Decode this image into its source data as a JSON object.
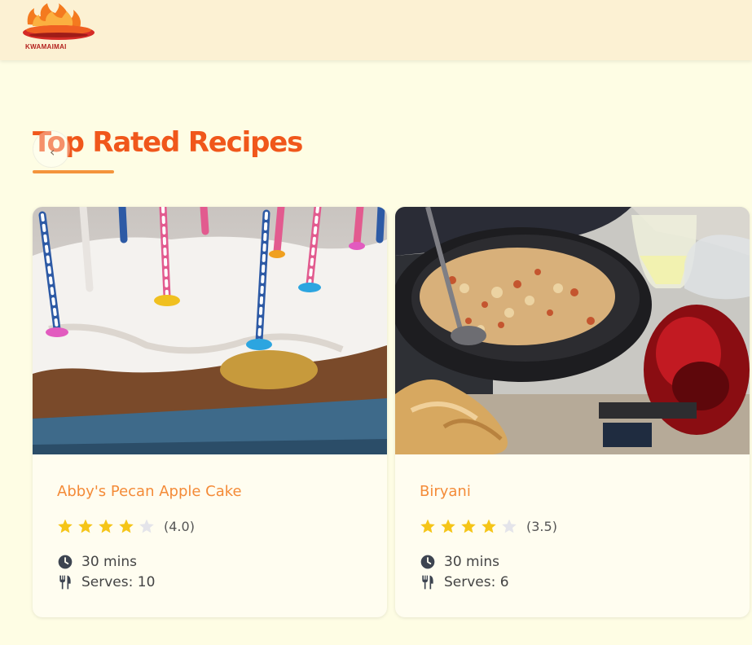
{
  "header": {
    "logo_text": "KWAMAIMAI",
    "logo_icon": "flame-logo-icon"
  },
  "colors": {
    "header_bg": "#fcf1d3",
    "page_bg": "#fefde4",
    "title": "#f0571b",
    "accent": "#f4943c",
    "card_title": "#f48b38",
    "star": "#f5c518",
    "star_empty": "#e4e4ea"
  },
  "section": {
    "title": "Top Rated Recipes",
    "prev_icon": "chevron-left-icon"
  },
  "recipes": [
    {
      "title": "Abby's Pecan Apple Cake",
      "rating": 4.0,
      "rating_label": "(4.0)",
      "stars": [
        true,
        true,
        true,
        true,
        false
      ],
      "time": "30 mins",
      "serves": "Serves: 10",
      "image_icon": "cake-photo"
    },
    {
      "title": "Biryani",
      "rating": 3.5,
      "rating_label": "(3.5)",
      "stars": [
        true,
        true,
        true,
        true,
        false
      ],
      "time": "30 mins",
      "serves": "Serves: 6",
      "image_icon": "biryani-photo"
    }
  ]
}
